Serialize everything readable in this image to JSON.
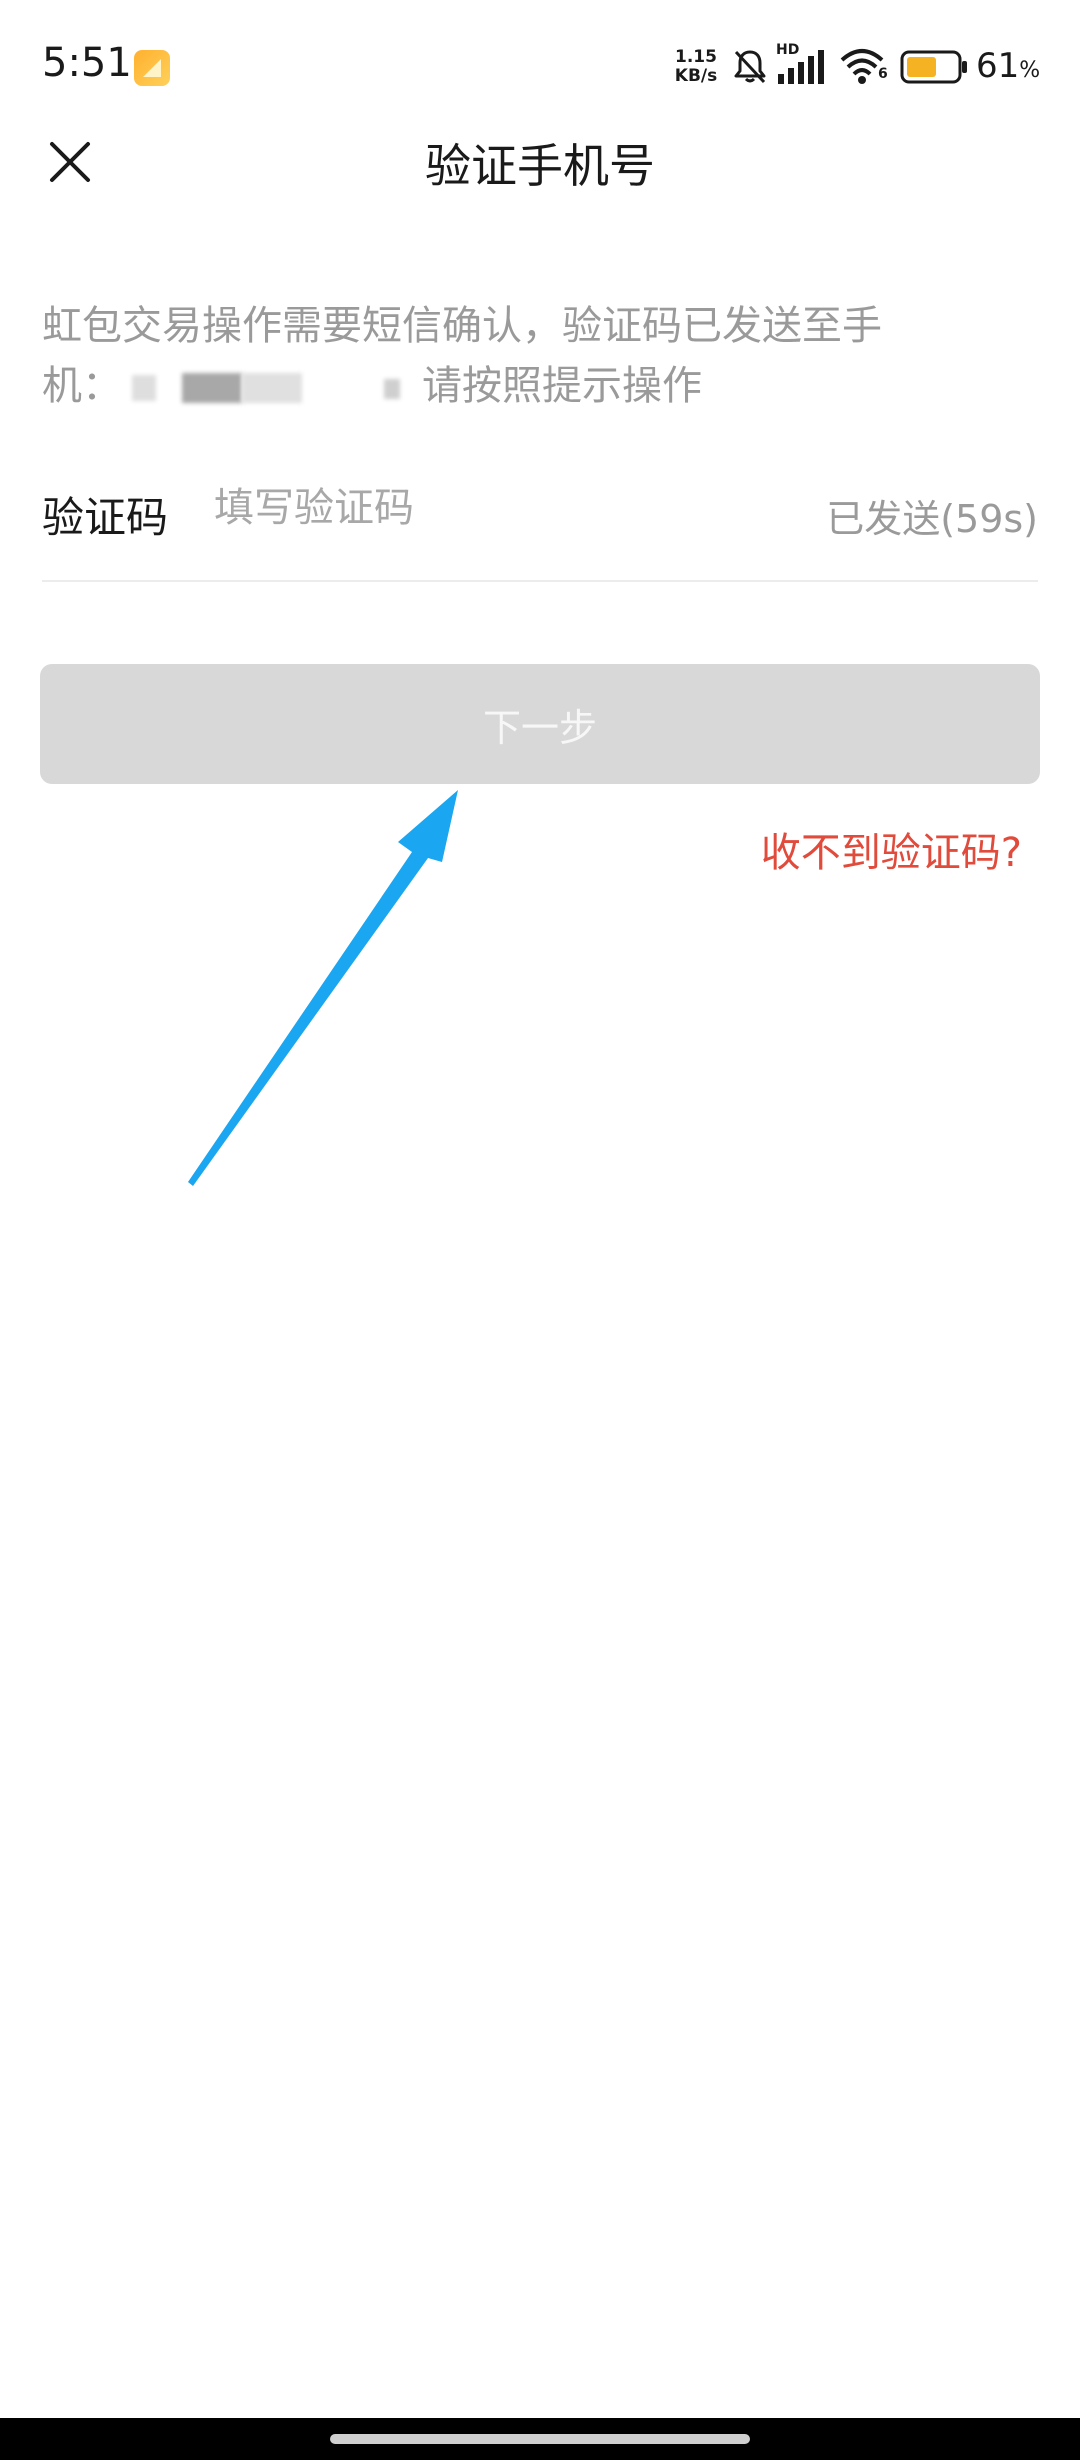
{
  "status_bar": {
    "time": "5:51",
    "net_speed_value": "1.15",
    "net_speed_unit": "KB/s",
    "hd_label": "HD",
    "wifi_sub": "6",
    "battery_percent": "61",
    "battery_percent_sign": "%",
    "battery_level": 0.61,
    "icons": [
      "app-notification-icon",
      "mute-bell-icon",
      "signal-icon",
      "wifi-icon",
      "battery-icon"
    ]
  },
  "header": {
    "title": "验证手机号",
    "close_icon": "close-icon"
  },
  "description": {
    "line1": "虹包交易操作需要短信确认，验证码已发送至手",
    "line2_prefix": "机：",
    "line2_suffix": "请按照提示操作"
  },
  "code_field": {
    "label": "验证码",
    "placeholder": "填写验证码",
    "value": "",
    "resend_status": "已发送(59s)"
  },
  "next_button": {
    "label": "下一步"
  },
  "help_link": {
    "label": "收不到验证码?"
  },
  "colors": {
    "accent_red": "#e04b3c",
    "button_disabled": "#d8d8d8",
    "annotation_arrow": "#1aa6f0"
  }
}
